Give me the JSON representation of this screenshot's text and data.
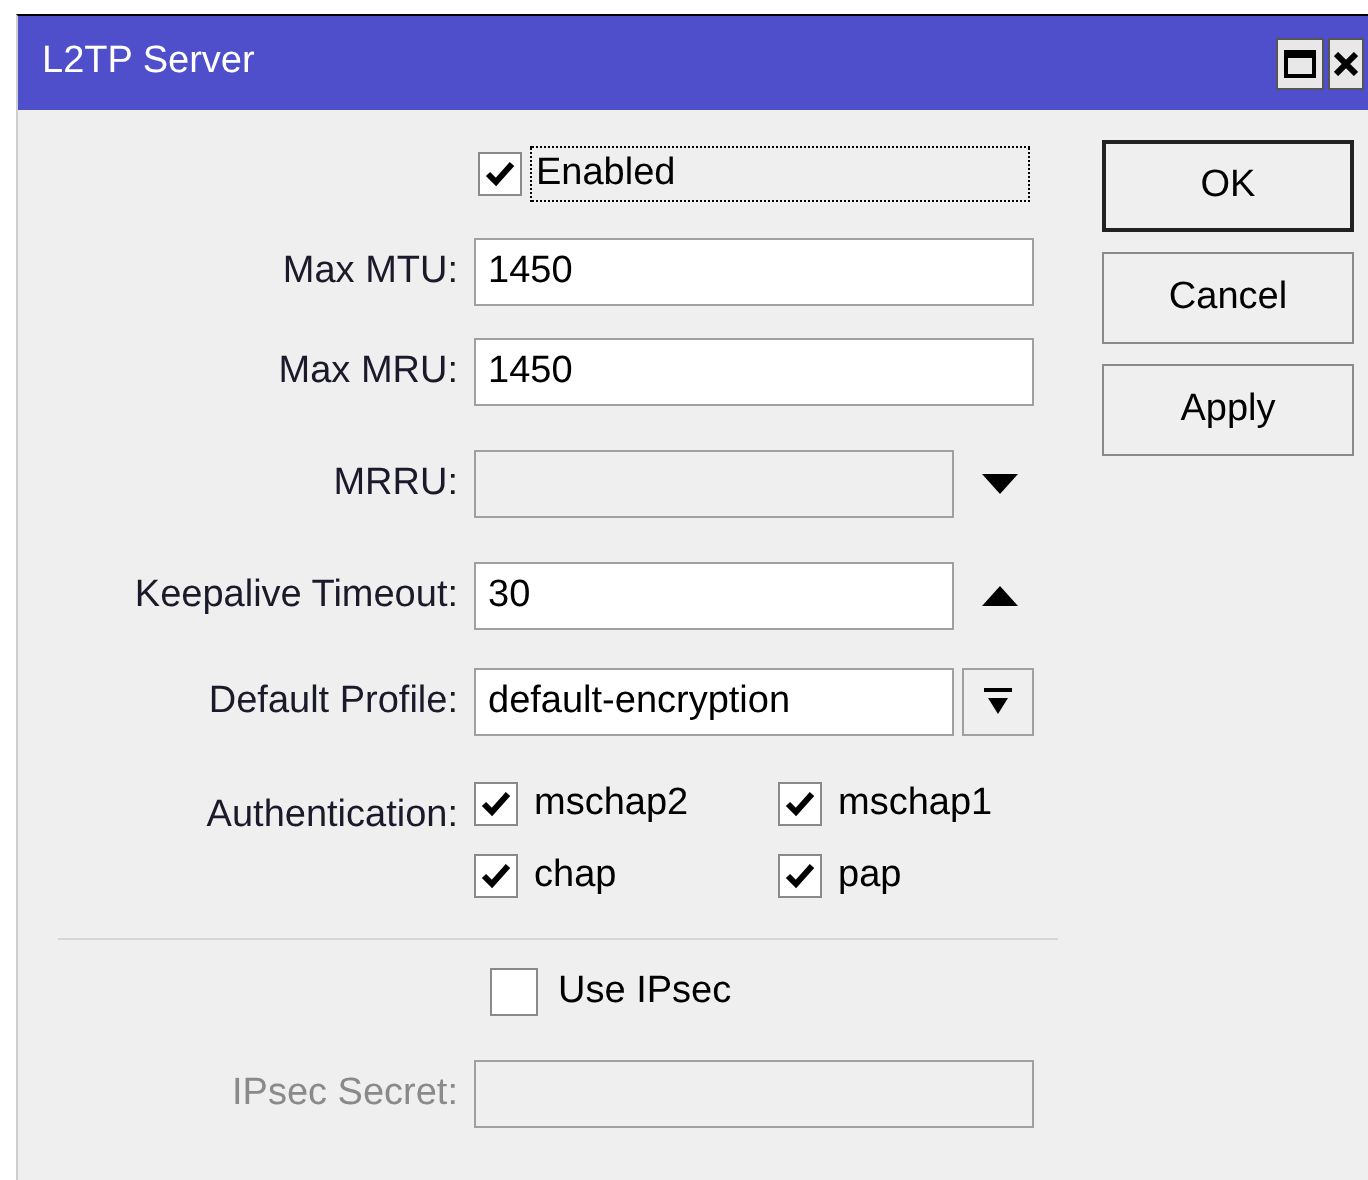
{
  "window": {
    "title": "L2TP Server"
  },
  "enabled": {
    "label": "Enabled",
    "checked": true,
    "focused": true
  },
  "fields": [
    {
      "label": "Max MTU:",
      "value": "1450",
      "kind": "text",
      "disabled": false,
      "unset": false
    },
    {
      "label": "Max MRU:",
      "value": "1450",
      "kind": "text",
      "disabled": false,
      "unset": false
    },
    {
      "label": "MRRU:",
      "kind": "spin-down",
      "disabled": false,
      "unset": true
    },
    {
      "label": "Keepalive Timeout:",
      "value": "30",
      "kind": "spin-up",
      "disabled": false,
      "unset": false
    },
    {
      "label": "Default Profile:",
      "value": "default-encryption",
      "kind": "dropdown",
      "disabled": false,
      "unset": false
    }
  ],
  "authentication": {
    "label": "Authentication:",
    "options": [
      {
        "label": "mschap2",
        "checked": true
      },
      {
        "label": "mschap1",
        "checked": true
      },
      {
        "label": "chap",
        "checked": true
      },
      {
        "label": "pap",
        "checked": true
      }
    ]
  },
  "use_ipsec": {
    "label": "Use IPsec",
    "checked": false
  },
  "ipsec_secret": {
    "label": "IPsec Secret:",
    "disabled": true
  },
  "buttons": [
    {
      "label": "OK",
      "default": true
    },
    {
      "label": "Cancel",
      "default": false
    },
    {
      "label": "Apply",
      "default": false
    }
  ]
}
